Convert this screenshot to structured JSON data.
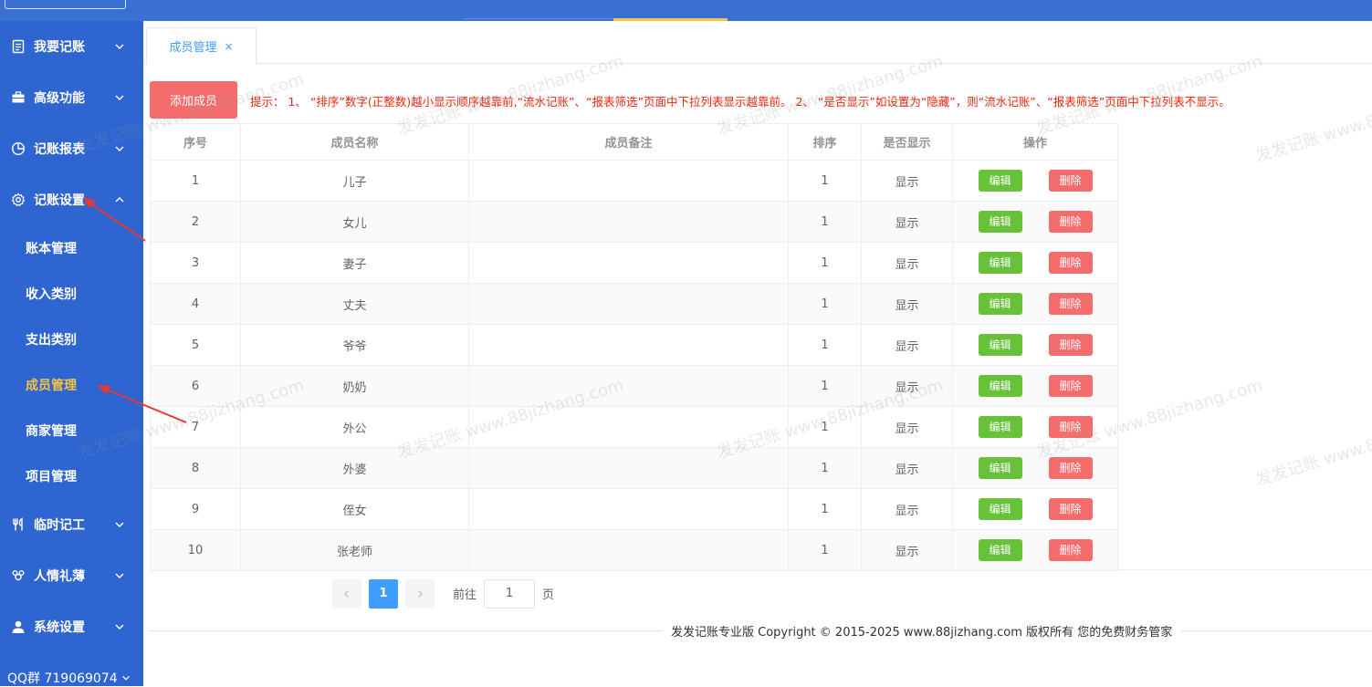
{
  "colors": {
    "sidebar": "#2e65d0",
    "topbar": "#3a6fd4",
    "accent": "#f5c542",
    "primary": "#409eff",
    "danger": "#f56c6c",
    "success": "#67c23a",
    "hint": "#e8250f"
  },
  "sidebar": {
    "items": [
      {
        "label": "我要记账",
        "icon": "document-icon"
      },
      {
        "label": "高级功能",
        "icon": "briefcase-icon"
      },
      {
        "label": "记账报表",
        "icon": "pie-chart-icon"
      },
      {
        "label": "记账设置",
        "icon": "gear-icon"
      }
    ],
    "sub_items": [
      {
        "label": "账本管理"
      },
      {
        "label": "收入类别"
      },
      {
        "label": "支出类别"
      },
      {
        "label": "成员管理"
      },
      {
        "label": "商家管理"
      },
      {
        "label": "项目管理"
      }
    ],
    "items_bottom": [
      {
        "label": "临时记工",
        "icon": "utensils-icon"
      },
      {
        "label": "人情礼薄",
        "icon": "gift-icon"
      },
      {
        "label": "系统设置",
        "icon": "user-icon"
      }
    ],
    "qq": "QQ群 719069074"
  },
  "tabs": [
    {
      "label": "成员管理",
      "close": "×"
    }
  ],
  "toolbar": {
    "add_label": "添加成员",
    "hint": "提示： 1、 “排序”数字(正整数)越小显示顺序越靠前,“流水记账”、“报表筛选”页面中下拉列表显示越靠前。 2、 “是否显示”如设置为“隐藏”，则“流水记账”、“报表筛选”页面中下拉列表不显示。"
  },
  "table": {
    "headers": [
      "序号",
      "成员名称",
      "成员备注",
      "排序",
      "是否显示",
      "操作"
    ],
    "edit_label": "编辑",
    "delete_label": "删除",
    "rows": [
      {
        "no": "1",
        "name": "儿子",
        "note": "",
        "sort": "1",
        "show": "显示"
      },
      {
        "no": "2",
        "name": "女儿",
        "note": "",
        "sort": "1",
        "show": "显示"
      },
      {
        "no": "3",
        "name": "妻子",
        "note": "",
        "sort": "1",
        "show": "显示"
      },
      {
        "no": "4",
        "name": "丈夫",
        "note": "",
        "sort": "1",
        "show": "显示"
      },
      {
        "no": "5",
        "name": "爷爷",
        "note": "",
        "sort": "1",
        "show": "显示"
      },
      {
        "no": "6",
        "name": "奶奶",
        "note": "",
        "sort": "1",
        "show": "显示"
      },
      {
        "no": "7",
        "name": "外公",
        "note": "",
        "sort": "1",
        "show": "显示"
      },
      {
        "no": "8",
        "name": "外婆",
        "note": "",
        "sort": "1",
        "show": "显示"
      },
      {
        "no": "9",
        "name": "侄女",
        "note": "",
        "sort": "1",
        "show": "显示"
      },
      {
        "no": "10",
        "name": "张老师",
        "note": "",
        "sort": "1",
        "show": "显示"
      }
    ]
  },
  "pagination": {
    "current": "1",
    "goto_label": "前往",
    "goto_value": "1",
    "page_label": "页"
  },
  "footer": "发发记账专业版  Copyright © 2015-2025 www.88jizhang.com 版权所有   您的免费财务管家",
  "watermark": "发发记账 www.88jizhang.com"
}
